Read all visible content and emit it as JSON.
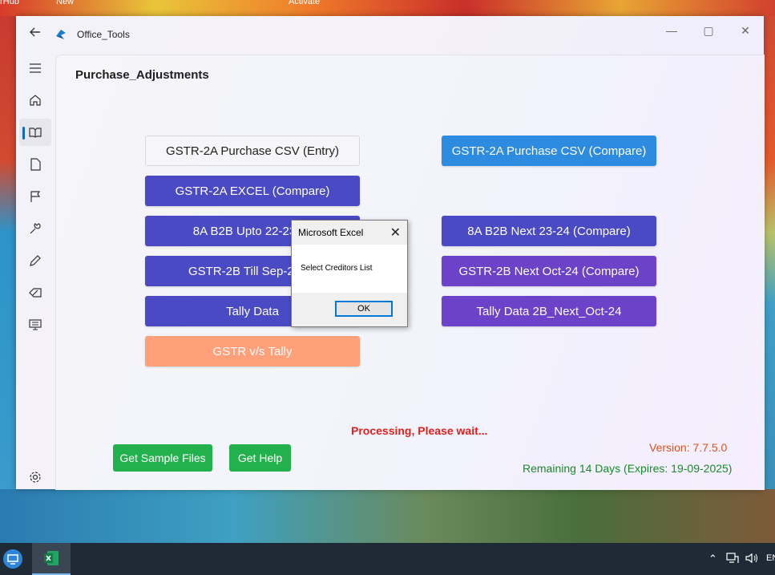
{
  "desktop": {
    "top_left_text": "rHub",
    "top_center_text": "New",
    "top_right_text": "Activate"
  },
  "window": {
    "app_title": "Office_Tools",
    "page_title": "Purchase_Adjustments"
  },
  "buttons": {
    "gstr2a_csv_entry": "GSTR-2A Purchase CSV (Entry)",
    "gstr2a_csv_compare": "GSTR-2A Purchase CSV (Compare)",
    "gstr2a_excel_compare": "GSTR-2A EXCEL (Compare)",
    "b2b_upto": "8A B2B Upto 22-23 (C",
    "b2b_next": "8A B2B Next 23-24 (Compare)",
    "gstr2b_till": "GSTR-2B Till Sep-24 (C",
    "gstr2b_next": "GSTR-2B Next Oct-24 (Compare)",
    "tally_data": "Tally Data",
    "tally_data_2b": "Tally Data 2B_Next_Oct-24",
    "gstr_vs_tally": "GSTR v/s Tally",
    "get_sample_files": "Get Sample Files",
    "get_help": "Get Help"
  },
  "status": {
    "processing": "Processing, Please wait...",
    "version": "Version: 7.7.5.0",
    "remaining": "Remaining 14 Days (Expires: 19-09-2025)"
  },
  "dialog": {
    "title": "Microsoft Excel",
    "message": "Select Creditors List",
    "ok_label": "OK"
  },
  "taskbar": {
    "lang": "EN"
  },
  "colors": {
    "blue": "#2d8be0",
    "indigo": "#4a4ac4",
    "purple": "#6b42c8",
    "salmon": "#ffa07a",
    "green": "#22b14c",
    "processing_red": "#e0201c",
    "version_orange": "#e0501c",
    "remaining_green": "#1a8a2a"
  }
}
